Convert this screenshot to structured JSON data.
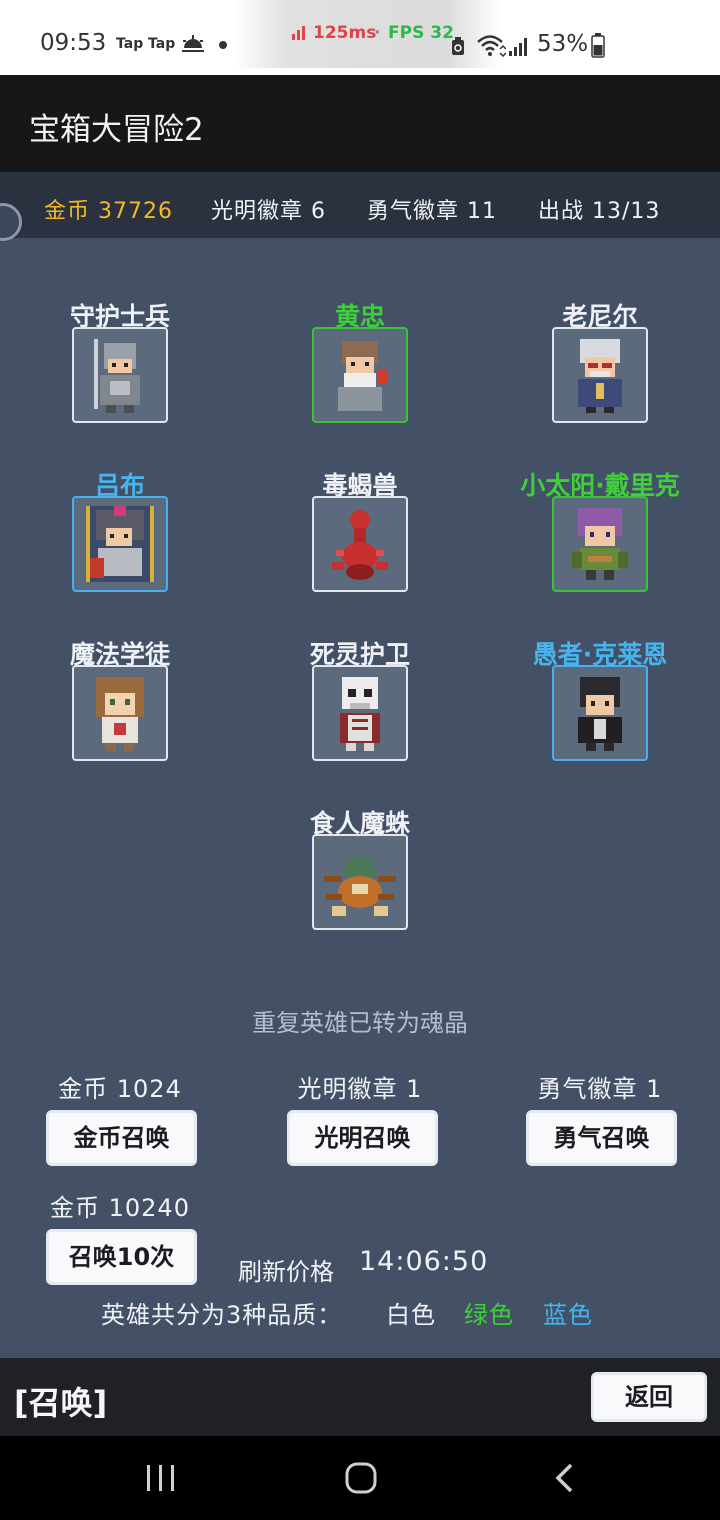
{
  "status_bar": {
    "time": "09:53",
    "apps": [
      "Tap",
      "Tap"
    ],
    "ping": "125ms",
    "separator": "·",
    "fps": "FPS 32",
    "battery": "53%",
    "icons": [
      "weather-icon",
      "cleaner-icon",
      "wifi-icon",
      "signal-icon",
      "battery-icon"
    ]
  },
  "app": {
    "title": "宝箱大冒险2"
  },
  "resources": {
    "gold": "金币 37726",
    "light_badge": "光明徽章 6",
    "courage_badge": "勇气徽章 11",
    "deployed": "出战 13/13"
  },
  "heroes": [
    {
      "name": "守护士兵",
      "tier": "white",
      "icon": "armored-soldier-sprite"
    },
    {
      "name": "黄忠",
      "tier": "green",
      "icon": "old-general-sprite"
    },
    {
      "name": "老尼尔",
      "tier": "white",
      "icon": "old-man-sprite"
    },
    {
      "name": "吕布",
      "tier": "blue",
      "icon": "warlord-sprite"
    },
    {
      "name": "毒蝎兽",
      "tier": "white",
      "icon": "scorpion-sprite"
    },
    {
      "name": "小太阳·戴里克",
      "tier": "green",
      "icon": "purple-hair-hero-sprite"
    },
    {
      "name": "魔法学徒",
      "tier": "white",
      "icon": "apprentice-mage-sprite"
    },
    {
      "name": "死灵护卫",
      "tier": "white",
      "icon": "skeleton-sprite"
    },
    {
      "name": "愚者·克莱恩",
      "tier": "blue",
      "icon": "dark-hair-hero-sprite"
    },
    {
      "name": "食人魔蛛",
      "tier": "white",
      "icon": "spider-sprite"
    }
  ],
  "notice": "重复英雄已转为魂晶",
  "summons": [
    {
      "cost": "金币 1024",
      "label": "金币召唤"
    },
    {
      "cost": "光明徽章 1",
      "label": "光明召唤"
    },
    {
      "cost": "勇气徽章 1",
      "label": "勇气召唤"
    },
    {
      "cost": "金币 10240",
      "label": "召唤10次"
    }
  ],
  "refresh": {
    "label": "刷新价格",
    "time": "14:06:50"
  },
  "quality": {
    "intro": "英雄共分为3种品质：",
    "white": "白色",
    "green": "绿色",
    "blue": "蓝色"
  },
  "colors": {
    "gold": "#f3b92b",
    "green_tier": "#3fcf3a",
    "blue_tier": "#47b4ee",
    "ping": "#e0434b",
    "fps": "#2db84a"
  },
  "footer": {
    "section": "[召唤]",
    "back": "返回"
  }
}
